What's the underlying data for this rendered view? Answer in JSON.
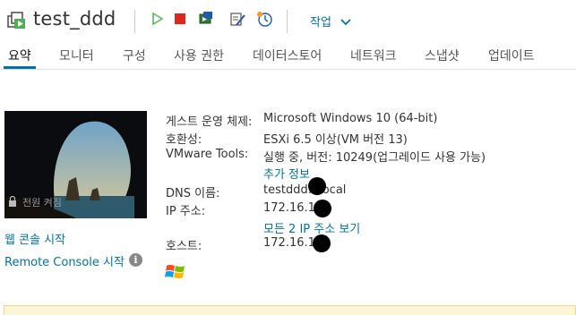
{
  "header": {
    "vm_name": "test_ddd",
    "actions_label": "작업",
    "toolbar_icons": [
      "power-on-icon",
      "power-off-icon",
      "console-icon",
      "edit-settings-icon",
      "snapshot-icon"
    ]
  },
  "tabs": [
    {
      "label": "요약",
      "active": true
    },
    {
      "label": "모니터",
      "active": false
    },
    {
      "label": "구성",
      "active": false
    },
    {
      "label": "사용 권한",
      "active": false
    },
    {
      "label": "데이터스토어",
      "active": false
    },
    {
      "label": "네트워크",
      "active": false
    },
    {
      "label": "스냅샷",
      "active": false
    },
    {
      "label": "업데이트",
      "active": false
    }
  ],
  "console": {
    "thumb_label": "전원 켜짐",
    "web_console_link": "웹 콘솔 시작",
    "remote_console_link": "Remote Console 시작"
  },
  "summary": {
    "guest_os_label": "게스트 운영 체제:",
    "guest_os_value": "Microsoft Windows 10 (64-bit)",
    "compat_label": "호환성:",
    "compat_value": "ESXi 6.5 이상(VM 버전 13)",
    "tools_label": "VMware Tools:",
    "tools_value": "실행 중, 버전: 10249(업그레이드 사용 가능)",
    "more_info_link": "추가 정보",
    "dns_label": "DNS 이름:",
    "dns_value": "testddd.   .local",
    "ip_label": "IP 주소:",
    "ip_value": "172.16.15.",
    "all_ip_link": "모든 2 IP 주소 보기",
    "host_label": "호스트:",
    "host_value": "172.16.15."
  },
  "colors": {
    "link": "#0072a3",
    "power_on": "#5cb85c",
    "power_off": "#d9281e",
    "warning_bg": "#fdf6d6"
  }
}
